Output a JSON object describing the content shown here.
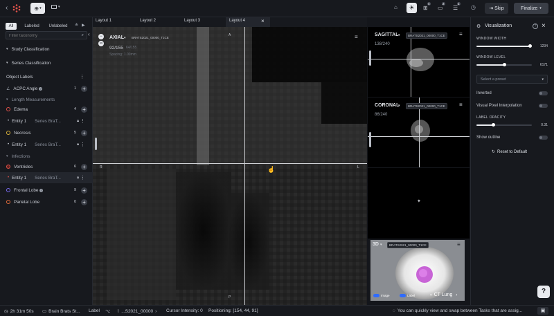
{
  "topbar": {
    "back_icon": "chevron-left",
    "tool_icon": "crosshair",
    "layout_icon": "layout",
    "badges": {
      "grid": "4",
      "comments": "2",
      "tasks": "1"
    },
    "skip_label": "Skip",
    "finalize_label": "Finalize"
  },
  "sidebar": {
    "filter_tabs": [
      "All",
      "Labeled",
      "Unlabeled"
    ],
    "active_filter": "All",
    "search_placeholder": "Filter taxonomy",
    "study_classification": "Study Classification",
    "series_classification": "Series Classification",
    "object_labels": "Object Labels",
    "acpc": {
      "label": "ACPC Angle",
      "count": "1"
    },
    "length_measurements": "Length Measurements",
    "edema": {
      "label": "Edema",
      "count": "4"
    },
    "edema_entity": {
      "label": "Entity 1",
      "series": "Series BraT..."
    },
    "necrosis": {
      "label": "Necrosis",
      "count": "5"
    },
    "necrosis_entity": {
      "label": "Entity 1",
      "series": "Series BraT..."
    },
    "infections": "Infections",
    "ventricles": {
      "label": "Ventricles",
      "count": "6"
    },
    "ventricles_entity": {
      "label": "Entity 1",
      "series": "Series BraT..."
    },
    "frontal_lobe": {
      "label": "Frontal Lobe",
      "count": "9"
    },
    "parietal_lobe": {
      "label": "Parietal Lobe",
      "count": "0"
    }
  },
  "viewer": {
    "tabs": [
      "Layout 1",
      "Layout 2",
      "Layout 3",
      "Layout 4"
    ],
    "axial": {
      "label": "AXIAL",
      "series": "BRATS2021_00000_T1CE",
      "slice": "92/155",
      "slice_extra": "64/155",
      "spacing": "Spacing: 1.00mm",
      "marker_top": "A",
      "marker_left": "R",
      "marker_right": "L",
      "marker_bottom": "P"
    },
    "sagittal": {
      "label": "SAGITTAL",
      "series": "BRATS2021_00000_T1CE",
      "slice": "138/240"
    },
    "coronal": {
      "label": "CORONAL",
      "series": "BRATS2021_00000_T1CE",
      "slice": "86/240"
    },
    "three_d": {
      "label": "3D",
      "series": "BRATS2021_00000_T1CE",
      "toggle_image": "Image",
      "toggle_label": "Label",
      "preset": "CT Lung"
    }
  },
  "visualization": {
    "title": "Visualization",
    "window_width_label": "WINDOW WIDTH",
    "window_width_value": "1234",
    "window_width_fraction": 0.97,
    "window_level_label": "WINDOW LEVEL",
    "window_level_value": "6171",
    "window_level_fraction": 0.5,
    "preset_placeholder": "Select a preset",
    "inverted_label": "Inverted",
    "interp_label": "Visual Pixel Interpolation",
    "label_opacity_label": "LABEL OPACITY",
    "label_opacity_value": "0.31",
    "label_opacity_fraction": 0.31,
    "show_outline_label": "Show outline",
    "reset_label": "Reset to Default"
  },
  "statusbar": {
    "timer": "2h 31m 50s",
    "dataset": "Brain Brats St...",
    "label_tab": "Label",
    "file": "...S2021_00000",
    "cursor_intensity": "Cursor Intensity: 0",
    "positioning": "Positioning: [154, 44, 91]",
    "tip": "You can quickly view and swap between Tasks that are assig..."
  },
  "colors": {
    "accent": "#2f6bff",
    "edema": "#e0524a",
    "necrosis": "#d8b23c",
    "ventricles": "#e0524a",
    "frontal": "#7a6cf0",
    "parietal": "#e06a3a"
  }
}
